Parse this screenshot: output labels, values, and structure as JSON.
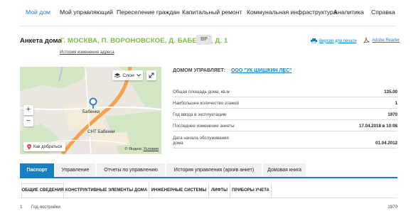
{
  "nav": {
    "items": [
      "Мой дом",
      "Мой управляющий",
      "Переселение граждан",
      "Капитальный ремонт",
      "Коммунальная инфраструктура",
      "Аналитика",
      "Справка"
    ],
    "active_index": 0,
    "accent_color": "#1a7fc1"
  },
  "header": {
    "label": "Анкета дома",
    "address": "Г. МОСКВА, П. ВОРОНОВСКОЕ, Д. БАБЕНКИ, Д. 1",
    "badge": "ВР",
    "address_history_link": "История изменения адреса",
    "address_color": "#80bd3f"
  },
  "tools": {
    "print_version": "Версия для печати",
    "adobe_reader": "Adobe Reader",
    "print_icon": "printer-icon",
    "adobe_icon": "adobe-icon"
  },
  "map": {
    "layers_label": "Слои",
    "route_label": "Как добраться",
    "place_label": "Бабенки",
    "village_label": "СНТ Бабенки",
    "copyright": "© Яндекс",
    "terms_link": "Условия",
    "zoom_in": "+",
    "zoom_out": "−"
  },
  "managed": {
    "label": "ДОМОМ УПРАВЛЯЕТ:",
    "company": "ООО \"УК ШИШКИН ЛЕС\""
  },
  "house_info": [
    {
      "label": "Общая площадь дома, кв.м",
      "value": "135.00"
    },
    {
      "label": "Наибольшее количество этажей",
      "value": "1"
    },
    {
      "label": "Год ввода в эксплуатацию",
      "value": "1970"
    },
    {
      "label": "Последнее изменение анкеты",
      "value": "17.04.2018 в 10:08"
    },
    {
      "label": "Дата начала обслуживания дома",
      "value": "01.04.2012"
    }
  ],
  "tabs": [
    "Паспорт",
    "Управление",
    "Отчеты по управлению",
    "История управления (архив анкет)",
    "Домовая книга"
  ],
  "active_tab": 0,
  "subtabs": [
    "ОБЩИЕ СВЕДЕНИЯ",
    "КОНСТРУКТИВНЫЕ ЭЛЕМЕНТЫ ДОМА",
    "ИНЖЕНЕРНЫЕ СИСТЕМЫ",
    "ЛИФТЫ",
    "ПРИБОРЫ УЧЕТА"
  ],
  "active_subtab": 0,
  "params": [
    {
      "num": "1",
      "name": "Год постройки",
      "value": "1970"
    }
  ]
}
